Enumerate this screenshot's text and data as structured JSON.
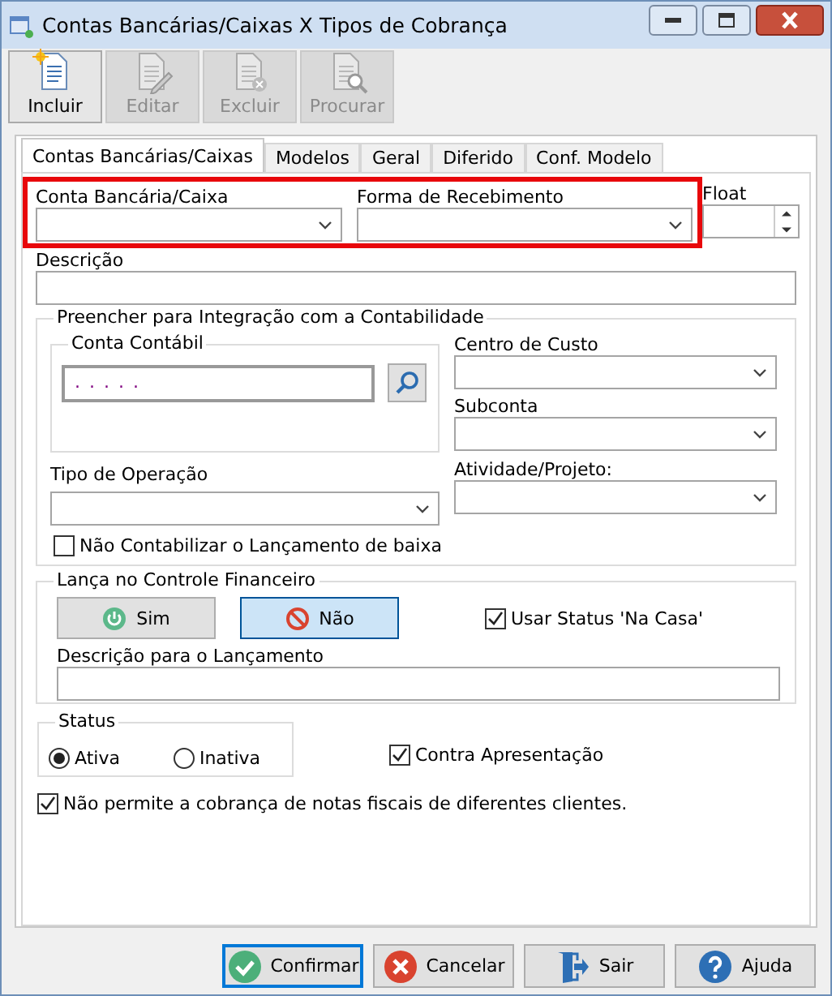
{
  "window": {
    "title": "Contas Bancárias/Caixas X Tipos de Cobrança"
  },
  "toolbar": [
    {
      "label": "Incluir",
      "kind": "new",
      "disabled": false
    },
    {
      "label": "Editar",
      "kind": "edit",
      "disabled": true
    },
    {
      "label": "Excluir",
      "kind": "delete",
      "disabled": true
    },
    {
      "label": "Procurar",
      "kind": "find",
      "disabled": true
    }
  ],
  "tabs": [
    {
      "label": "Contas Bancárias/Caixas",
      "selected": true
    },
    {
      "label": "Modelos",
      "selected": false
    },
    {
      "label": "Geral",
      "selected": false
    },
    {
      "label": "Diferido",
      "selected": false
    },
    {
      "label": "Conf. Modelo",
      "selected": false
    }
  ],
  "highlight": true,
  "conta_bancaria": {
    "label": "Conta Bancária/Caixa"
  },
  "forma_recebimento": {
    "label": "Forma de Recebimento"
  },
  "float": {
    "label": "Float"
  },
  "descricao": {
    "label": "Descrição"
  },
  "integracao": {
    "title": "Preencher para Integração com a Contabilidade",
    "conta_contabil": {
      "label": "Conta Contábil",
      "value": ". . . . ."
    },
    "centro_custo": {
      "label": "Centro de Custo"
    },
    "subconta": {
      "label": "Subconta"
    },
    "tipo_operacao": {
      "label": "Tipo de Operação"
    },
    "atividade": {
      "label": "Atividade/Projeto:"
    },
    "nao_contabilizar": {
      "label": "Não Contabilizar o Lançamento de baixa",
      "checked": false
    }
  },
  "financeiro": {
    "title": "Lança no Controle Financeiro",
    "buttons": [
      {
        "label": "Sim",
        "kind": "yes",
        "selected": false
      },
      {
        "label": "Não",
        "kind": "no",
        "selected": true
      }
    ],
    "usar_status": {
      "label": "Usar Status 'Na Casa'",
      "checked": true
    },
    "descricao_lancamento": {
      "label": "Descrição para o Lançamento"
    }
  },
  "status": {
    "title": "Status",
    "options": [
      {
        "label": "Ativa",
        "selected": true
      },
      {
        "label": "Inativa",
        "selected": false
      }
    ]
  },
  "contra_apresentacao": {
    "label": "Contra Apresentação",
    "checked": true
  },
  "nao_permite": {
    "label": "Não permite a cobrança de notas fiscais de diferentes clientes.",
    "checked": true
  },
  "footer": [
    {
      "label": "Confirmar",
      "kind": "confirm",
      "focused": true
    },
    {
      "label": "Cancelar",
      "kind": "cancel",
      "focused": false
    },
    {
      "label": "Sair",
      "kind": "exit",
      "focused": false
    },
    {
      "label": "Ajuda",
      "kind": "help",
      "focused": false
    }
  ]
}
